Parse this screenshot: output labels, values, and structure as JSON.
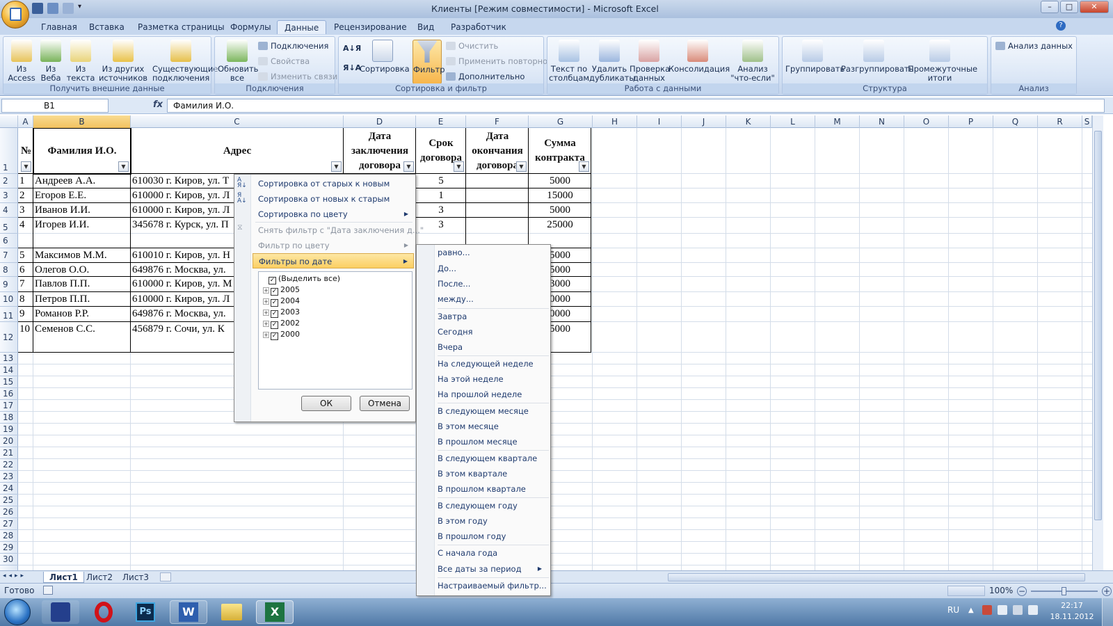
{
  "window": {
    "title": "Клиенты  [Режим совместимости] - Microsoft Excel"
  },
  "window_controls": {
    "minimize": "–",
    "maximize": "□",
    "close": "✕"
  },
  "ribbon_tabs": [
    "Главная",
    "Вставка",
    "Разметка страницы",
    "Формулы",
    "Данные",
    "Рецензирование",
    "Вид",
    "Разработчик"
  ],
  "ribbon": {
    "groups": {
      "external": "Получить внешние данные",
      "connections": "Подключения",
      "sortfilter": "Сортировка и фильтр",
      "datatools": "Работа с данными",
      "outline": "Структура",
      "analysis": "Анализ"
    },
    "buttons": {
      "access_1": "Из",
      "access_2": "Access",
      "web_1": "Из",
      "web_2": "Веба",
      "text_1": "Из",
      "text_2": "текста",
      "other_1": "Из других",
      "other_2": "источников",
      "existing_1": "Существующие",
      "existing_2": "подключения",
      "refresh_1": "Обновить",
      "refresh_2": "все",
      "connections": "Подключения",
      "properties": "Свойства",
      "edit_links": "Изменить связи",
      "sort": "Сортировка",
      "filter": "Фильтр",
      "clear": "Очистить",
      "reapply": "Применить повторно",
      "advanced": "Дополнительно",
      "text_cols_1": "Текст по",
      "text_cols_2": "столбцам",
      "remove_dup_1": "Удалить",
      "remove_dup_2": "дубликаты",
      "validation_1": "Проверка",
      "validation_2": "данных",
      "consolidate": "Консолидация",
      "whatif_1": "Анализ",
      "whatif_2": "\"что-если\"",
      "group": "Группировать",
      "ungroup": "Разгруппировать",
      "subtotal_1": "Промежуточные",
      "subtotal_2": "итоги",
      "data_analysis": "Анализ данных"
    }
  },
  "formula_bar": {
    "name_box": "B1",
    "fx": "fx",
    "formula": "Фамилия И.О."
  },
  "columns": [
    "A",
    "B",
    "C",
    "D",
    "E",
    "F",
    "G",
    "H",
    "I",
    "J",
    "K",
    "L",
    "M",
    "N",
    "O",
    "P",
    "Q",
    "R",
    "S"
  ],
  "rows": [
    "1",
    "2",
    "3",
    "4",
    "5",
    "6",
    "7",
    "8",
    "9",
    "10",
    "11",
    "12",
    "13",
    "14",
    "15",
    "16",
    "17",
    "18",
    "19",
    "20",
    "21",
    "22",
    "23",
    "24",
    "25",
    "26",
    "27",
    "28",
    "29",
    "30"
  ],
  "table": {
    "headers": {
      "num": "№",
      "name": "Фамилия И.О.",
      "address": "Адрес",
      "date_start": "Дата заключения договора",
      "term": "Срок договора",
      "date_end": "Дата окончания договора",
      "sum": "Сумма контракта"
    },
    "rows": [
      {
        "num": "1",
        "name": "Андреев А.А.",
        "addr": "610030 г. Киров, ул. Т",
        "term": "5",
        "sum": "5000"
      },
      {
        "num": "2",
        "name": "Егоров Е.Е.",
        "addr": "610000 г. Киров, ул. Л",
        "term": "1",
        "sum": "15000"
      },
      {
        "num": "3",
        "name": "Иванов И.И.",
        "addr": "610000 г. Киров, ул. Л",
        "term": "3",
        "sum": "5000"
      },
      {
        "num": "4",
        "name": "Игорев И.И.",
        "addr": "345678 г. Курск, ул. П",
        "term": "3",
        "sum": "25000"
      },
      {
        "num": "5",
        "name": "Максимов М.М.",
        "addr": "610010 г. Киров, ул. Н",
        "term": "",
        "sum": "5000"
      },
      {
        "num": "6",
        "name": "Олегов О.О.",
        "addr": "649876 г. Москва, ул.",
        "term": "",
        "sum": "5000"
      },
      {
        "num": "7",
        "name": "Павлов П.П.",
        "addr": "610000 г. Киров, ул. М",
        "term": "",
        "sum": "3000"
      },
      {
        "num": "8",
        "name": "Петров П.П.",
        "addr": "610000 г. Киров, ул. Л",
        "term": "",
        "sum": "0000"
      },
      {
        "num": "9",
        "name": "Романов Р.Р.",
        "addr": "649876 г. Москва, ул.",
        "term": "",
        "sum": "0000"
      },
      {
        "num": "10",
        "name": "Семенов С.С.",
        "addr": "456879 г. Сочи, ул. К",
        "term": "",
        "sum": "5000"
      }
    ]
  },
  "filter_menu": {
    "sort_old_new": "Сортировка от старых к новым",
    "sort_new_old": "Сортировка от новых к старым",
    "sort_color": "Сортировка по цвету",
    "clear_filter": "Снять фильтр с \"Дата заключения д...\"",
    "filter_color": "Фильтр по цвету",
    "date_filters": "Фильтры по дате",
    "tree": {
      "select_all": "(Выделить все)",
      "years": [
        "2005",
        "2004",
        "2003",
        "2002",
        "2000"
      ]
    },
    "ok": "ОК",
    "cancel": "Отмена"
  },
  "date_submenu": {
    "items": [
      "равно...",
      "До...",
      "После...",
      "между...",
      "Завтра",
      "Сегодня",
      "Вчера",
      "На следующей неделе",
      "На этой неделе",
      "На прошлой неделе",
      "В следующем месяце",
      "В этом месяце",
      "В прошлом месяце",
      "В следующем квартале",
      "В этом квартале",
      "В прошлом квартале",
      "В следующем году",
      "В этом году",
      "В прошлом году",
      "С начала года",
      "Все даты за период",
      "Настраиваемый фильтр..."
    ]
  },
  "sheets": [
    "Лист1",
    "Лист2",
    "Лист3"
  ],
  "status": {
    "ready": "Готово",
    "zoom": "100%"
  },
  "taskbar": {
    "lang": "RU",
    "time": "22:17",
    "date": "18.11.2012"
  }
}
